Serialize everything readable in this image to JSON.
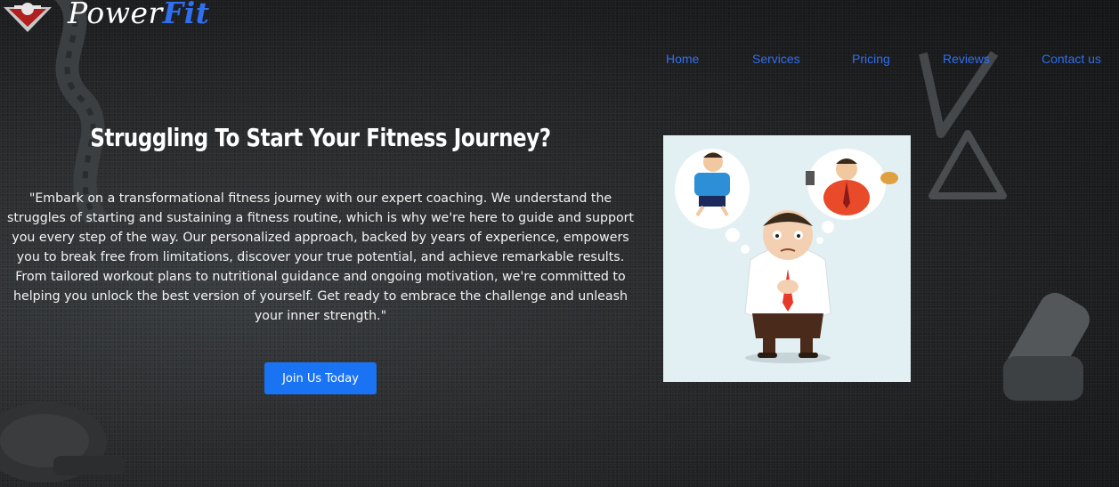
{
  "logo": {
    "part1": "Power",
    "part2": "Fit"
  },
  "nav": {
    "items": [
      "Home",
      "Services",
      "Pricing",
      "Reviews",
      "Contact us"
    ]
  },
  "hero": {
    "title": "Struggling To Start Your Fitness Journey?",
    "body": "\"Embark on a transformational fitness journey with our expert coaching. We understand the struggles of starting and sustaining a fitness routine, which is why we're here to guide and support you every step of the way. Our personalized approach, backed by years of experience, empowers you to break free from limitations, discover your true potential, and achieve remarkable results. From tailored workout plans to nutritional guidance and ongoing motivation, we're committed to helping you unlock the best version of yourself. Get ready to embrace the challenge and unleash your inner strength.\"",
    "cta_label": "Join Us Today"
  },
  "colors": {
    "accent": "#1a73f2",
    "nav_link": "#2f6ff0",
    "background": "#252729"
  }
}
